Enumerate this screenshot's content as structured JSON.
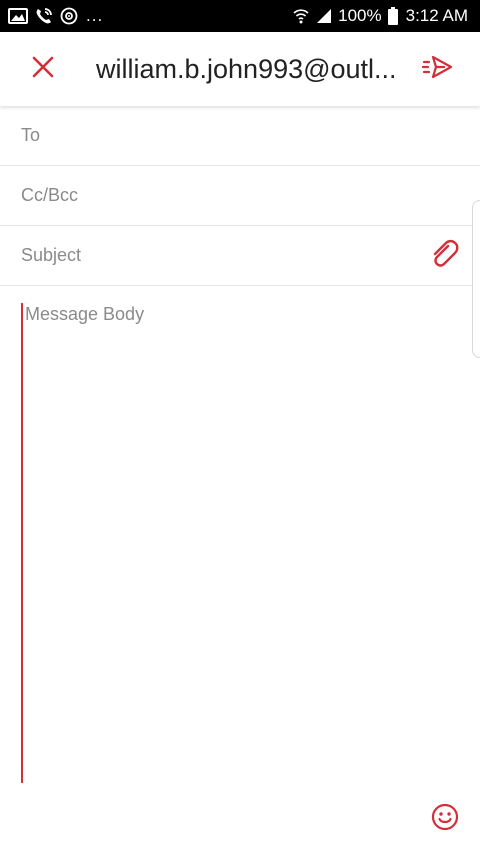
{
  "status_bar": {
    "left_icons": [
      "gallery-icon",
      "call-icon",
      "sync-icon"
    ],
    "overflow": "...",
    "battery": "100%",
    "time": "3:12 AM"
  },
  "toolbar": {
    "title": "william.b.john993@outl...",
    "close_icon": "close-icon",
    "send_icon": "send-icon"
  },
  "fields": {
    "to_placeholder": "To",
    "cc_placeholder": "Cc/Bcc",
    "subject_placeholder": "Subject",
    "body_placeholder": "Message Body"
  },
  "colors": {
    "accent": "#d32f3a",
    "status_bar": "#000000",
    "placeholder": "#8a8a8a",
    "divider": "#e6e6e6"
  }
}
